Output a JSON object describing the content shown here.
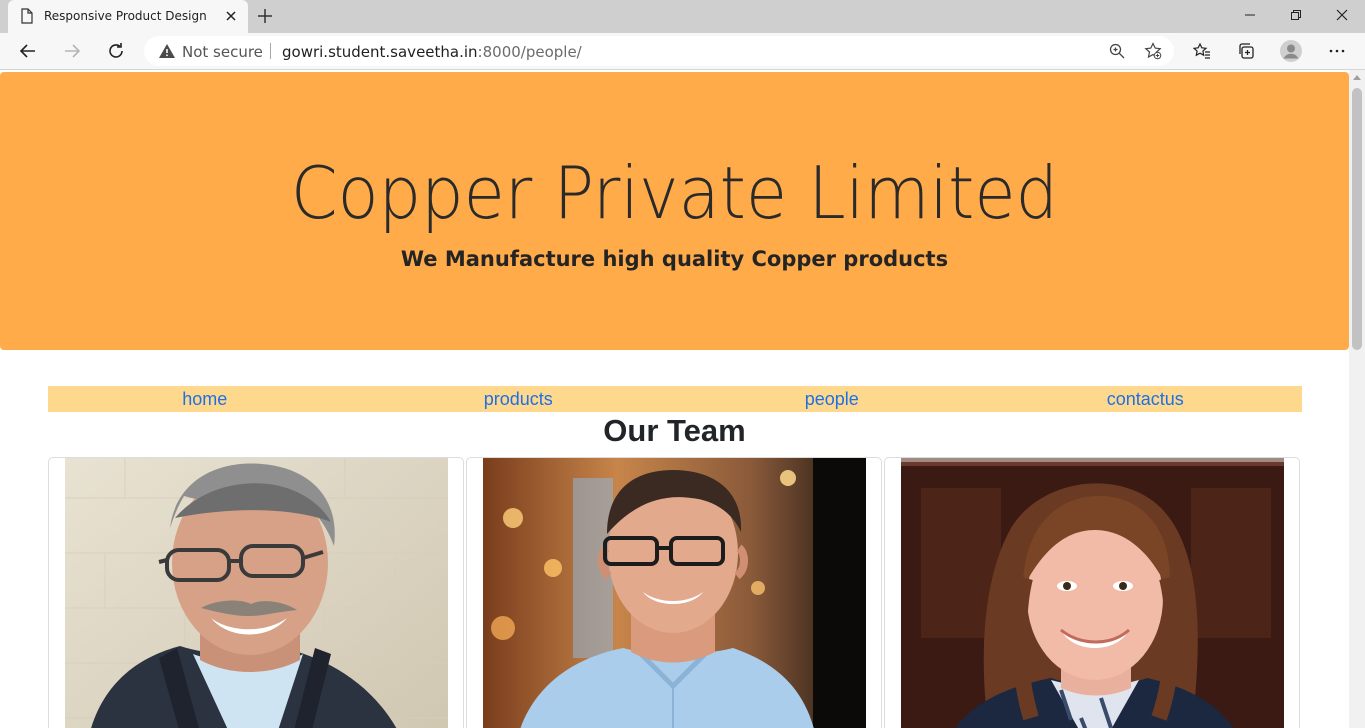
{
  "browser": {
    "tab_title": "Responsive Product Design",
    "security_label": "Not secure",
    "url_host": "gowri.student.saveetha.in",
    "url_rest": ":8000/people/"
  },
  "hero": {
    "title": "Copper Private Limited",
    "subtitle": "We Manufacture high quality Copper products",
    "background_color": "#ffab4a"
  },
  "nav": {
    "background_color": "#fed98d",
    "link_color": "#1f6fe5",
    "items": [
      {
        "label": "home"
      },
      {
        "label": "products"
      },
      {
        "label": "people"
      },
      {
        "label": "contactus"
      }
    ]
  },
  "team": {
    "heading": "Our Team",
    "members": [
      {
        "photo_icon": "man-gray-hair-glasses-photo"
      },
      {
        "photo_icon": "man-glasses-blue-shirt-photo"
      },
      {
        "photo_icon": "woman-brown-hair-photo"
      }
    ]
  }
}
